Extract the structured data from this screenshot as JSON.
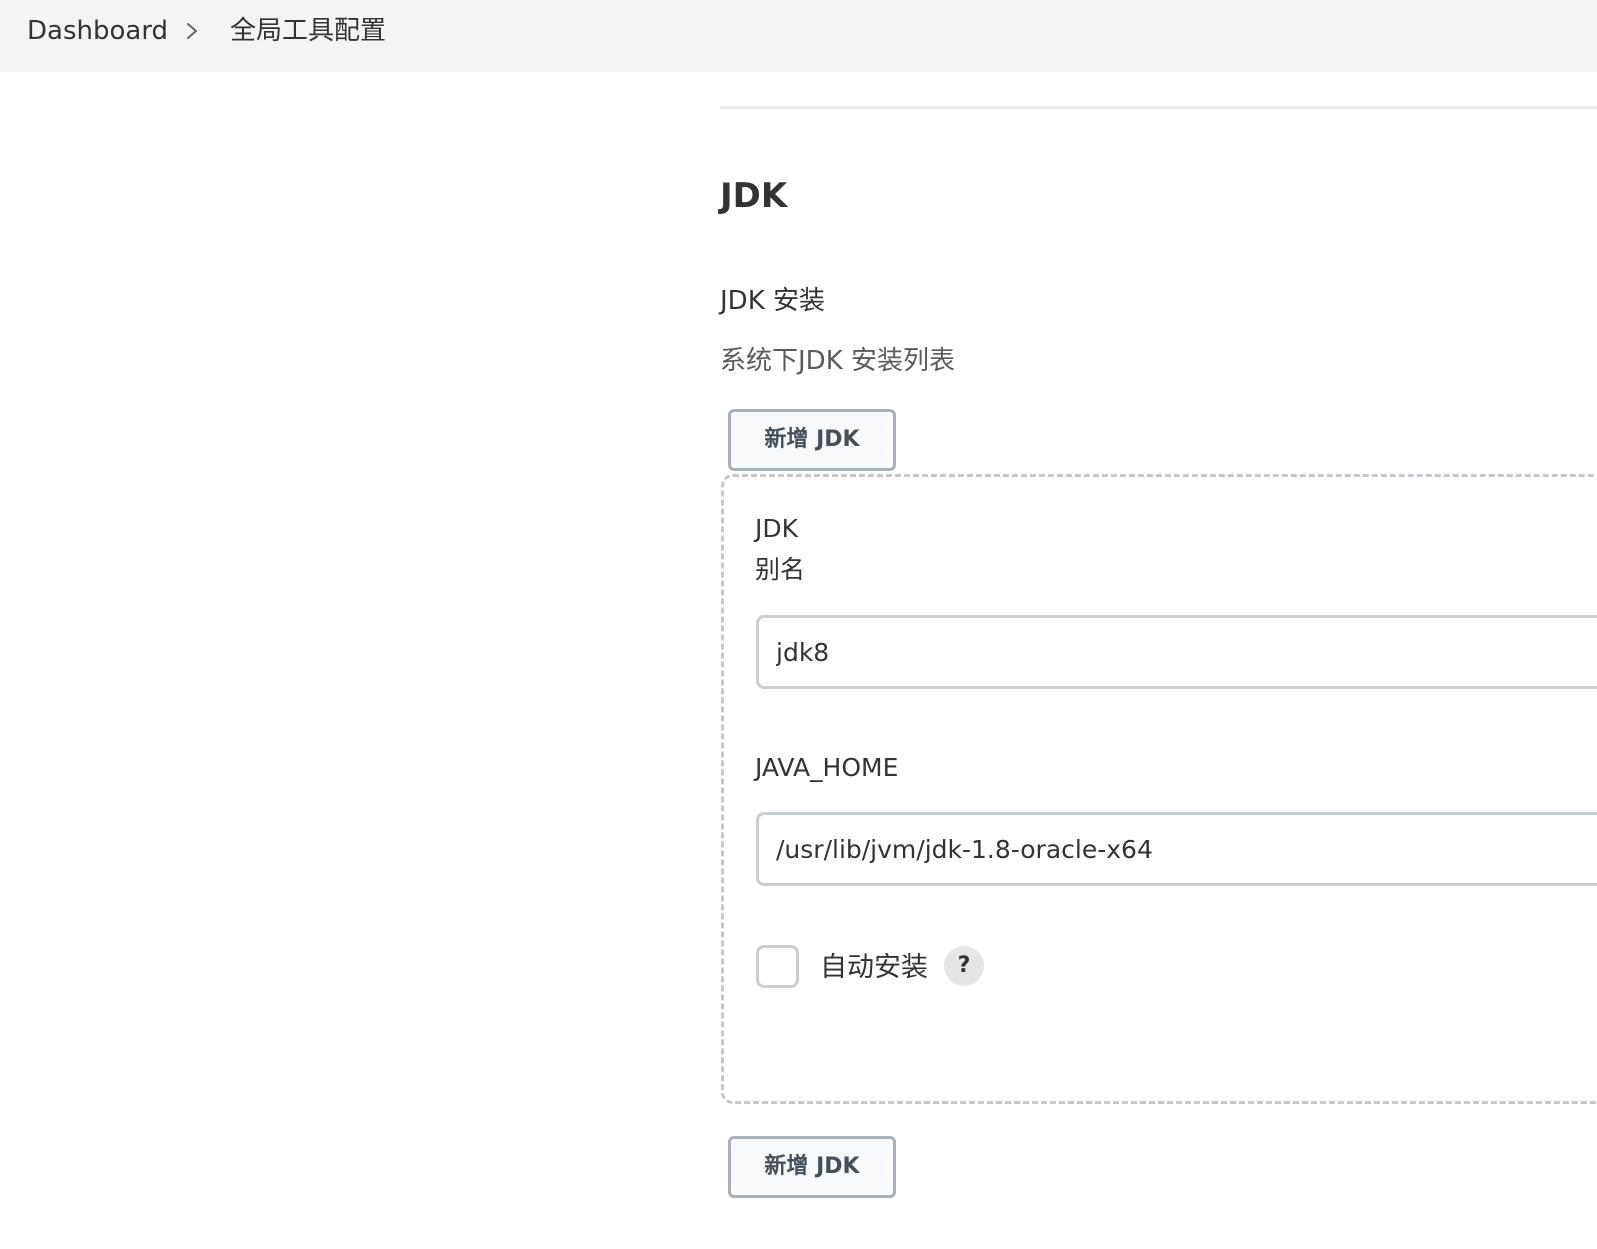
{
  "breadcrumb": {
    "home": "Dashboard",
    "separator_icon": "chevron-right-icon",
    "current": "全局工具配置"
  },
  "section": {
    "title": "JDK"
  },
  "jdk_installations": {
    "title": "JDK 安装",
    "description": "系统下JDK 安装列表",
    "add_button_label": "新增 JDK",
    "items": [
      {
        "header": "JDK",
        "alias_label": "别名",
        "alias_value": "jdk8",
        "java_home_label": "JAVA_HOME",
        "java_home_value": "/usr/lib/jvm/jdk-1.8-oracle-x64",
        "auto_install_label": "自动安装",
        "auto_install_checked": false,
        "help_label": "?"
      }
    ]
  },
  "colors": {
    "topbar_bg": "#f4f4f4",
    "button_border": "#a7b1b9",
    "input_border": "#c7ced4",
    "dashed_border": "#c3c8cc"
  }
}
